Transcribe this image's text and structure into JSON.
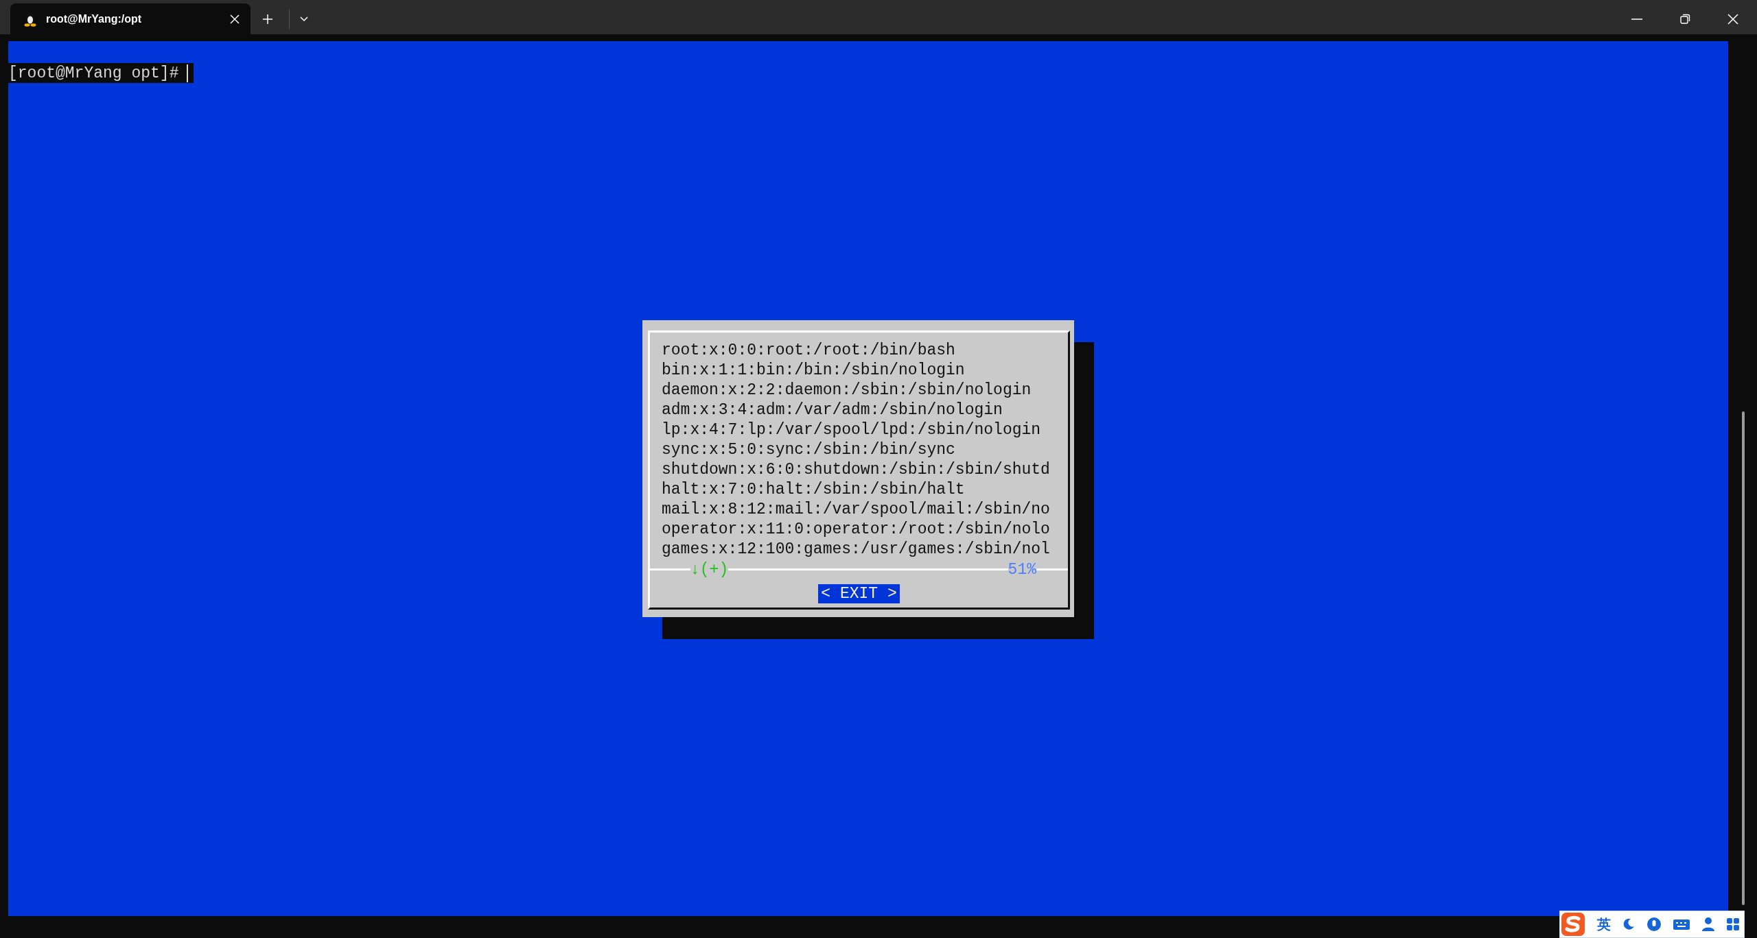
{
  "tab": {
    "title": "root@MrYang:/opt",
    "selected": true
  },
  "terminal": {
    "prompt": "[root@MrYang opt]#"
  },
  "dialog": {
    "lines": [
      "root:x:0:0:root:/root:/bin/bash",
      "bin:x:1:1:bin:/bin:/sbin/nologin",
      "daemon:x:2:2:daemon:/sbin:/sbin/nologin",
      "adm:x:3:4:adm:/var/adm:/sbin/nologin",
      "lp:x:4:7:lp:/var/spool/lpd:/sbin/nologin",
      "sync:x:5:0:sync:/sbin:/bin/sync",
      "shutdown:x:6:0:shutdown:/sbin:/sbin/shutd",
      "halt:x:7:0:halt:/sbin:/sbin/halt",
      "mail:x:8:12:mail:/var/spool/mail:/sbin/no",
      "operator:x:11:0:operator:/root:/sbin/nolo",
      "games:x:12:100:games:/usr/games:/sbin/nol"
    ],
    "scroll_indicator": "↓(+)",
    "percent": "51%",
    "button": {
      "label": "< EXIT >",
      "selected": true
    }
  },
  "ime": {
    "mode": "英"
  }
}
